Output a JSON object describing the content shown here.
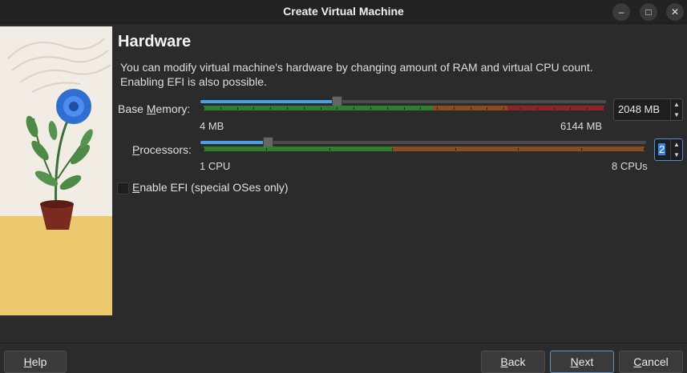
{
  "window": {
    "title": "Create Virtual Machine",
    "controls": {
      "minimize_icon": "minimize-icon",
      "maximize_icon": "maximize-icon",
      "close_icon": "close-icon"
    }
  },
  "page": {
    "heading": "Hardware",
    "description": "You can modify virtual machine's hardware by changing amount of RAM and virtual CPU count. Enabling EFI is also possible."
  },
  "memory": {
    "label_pre": "Base ",
    "label_mnemonic": "M",
    "label_post": "emory:",
    "min_label": "4 MB",
    "max_label": "6144 MB",
    "value": "2048 MB",
    "value_mb": 2048,
    "min_mb": 4,
    "max_mb": 6144
  },
  "processors": {
    "label_mnemonic": "P",
    "label_post": "rocessors:",
    "min_label": "1 CPU",
    "max_label": "8 CPUs",
    "value": "2",
    "value_num": 2,
    "min": 1,
    "max": 8
  },
  "efi": {
    "label_pre": "",
    "label_mnemonic": "E",
    "label_post": "nable EFI (special OSes only)",
    "checked": false
  },
  "buttons": {
    "help_mnemonic": "H",
    "help_post": "elp",
    "back_mnemonic": "B",
    "back_post": "ack",
    "next_mnemonic": "N",
    "next_post": "ext",
    "cancel_mnemonic": "C",
    "cancel_post": "ancel"
  },
  "colors": {
    "zone_green": "#2f7d2f",
    "zone_orange": "#8a4a22",
    "zone_red": "#8e2525",
    "slider_fill": "#4aa0e6",
    "accent": "#3584e4"
  }
}
